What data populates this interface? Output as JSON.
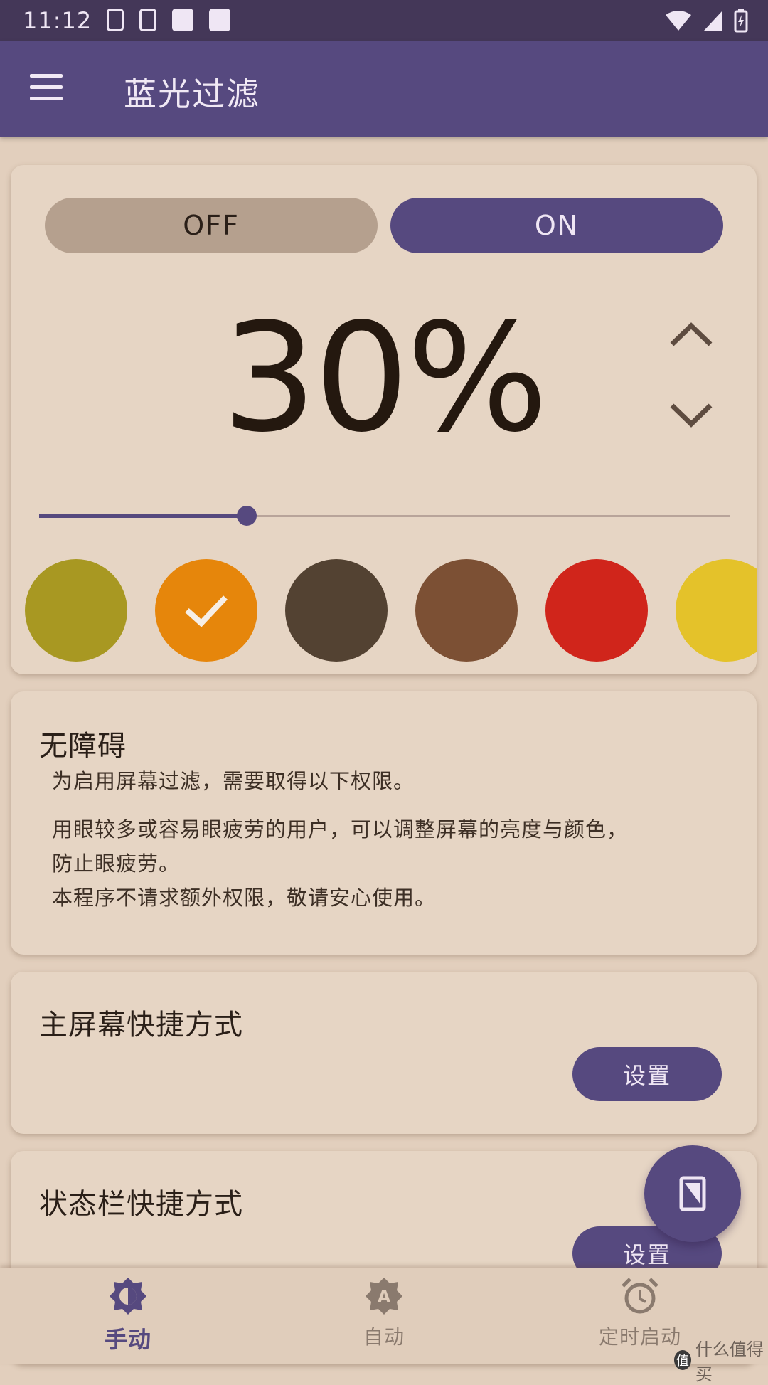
{
  "status_bar": {
    "time": "11:12"
  },
  "app_bar": {
    "title": "蓝光过滤",
    "menu_icon": "menu-icon"
  },
  "filter_card": {
    "off_label": "OFF",
    "on_label": "ON",
    "selected_toggle": "ON",
    "percent_text": "30%",
    "intensity_fraction": 0.3,
    "swatches": [
      {
        "color": "#a89822",
        "selected": false
      },
      {
        "color": "#e6860b",
        "selected": true
      },
      {
        "color": "#534232",
        "selected": false
      },
      {
        "color": "#7c5034",
        "selected": false
      },
      {
        "color": "#d0251b",
        "selected": false
      },
      {
        "color": "#e4c22a",
        "selected": false
      }
    ]
  },
  "accessibility_card": {
    "heading": "无障碍",
    "line1": "为启用屏幕过滤，需要取得以下权限。",
    "line2": "用眼较多或容易眼疲劳的用户，可以调整屏幕的亮度与颜色，",
    "line3": "防止眼疲劳。",
    "line4": "本程序不请求额外权限，敬请安心使用。"
  },
  "home_shortcut_card": {
    "heading": "主屏幕快捷方式",
    "button_label": "设置"
  },
  "statusbar_shortcut_card": {
    "heading": "状态栏快捷方式",
    "button_label": "设置"
  },
  "bottom_nav": {
    "items": [
      {
        "label": "手动",
        "icon": "brightness-icon",
        "active": true
      },
      {
        "label": "自动",
        "icon": "auto-brightness-icon",
        "active": false
      },
      {
        "label": "定时启动",
        "icon": "alarm-clock-icon",
        "active": false
      }
    ]
  },
  "watermark": {
    "badge": "值",
    "text": "什么值得买"
  },
  "colors": {
    "accent": "#56497f",
    "background": "#e2cfbd",
    "card": "#e6d5c4",
    "off_toggle": "#b5a08e"
  }
}
